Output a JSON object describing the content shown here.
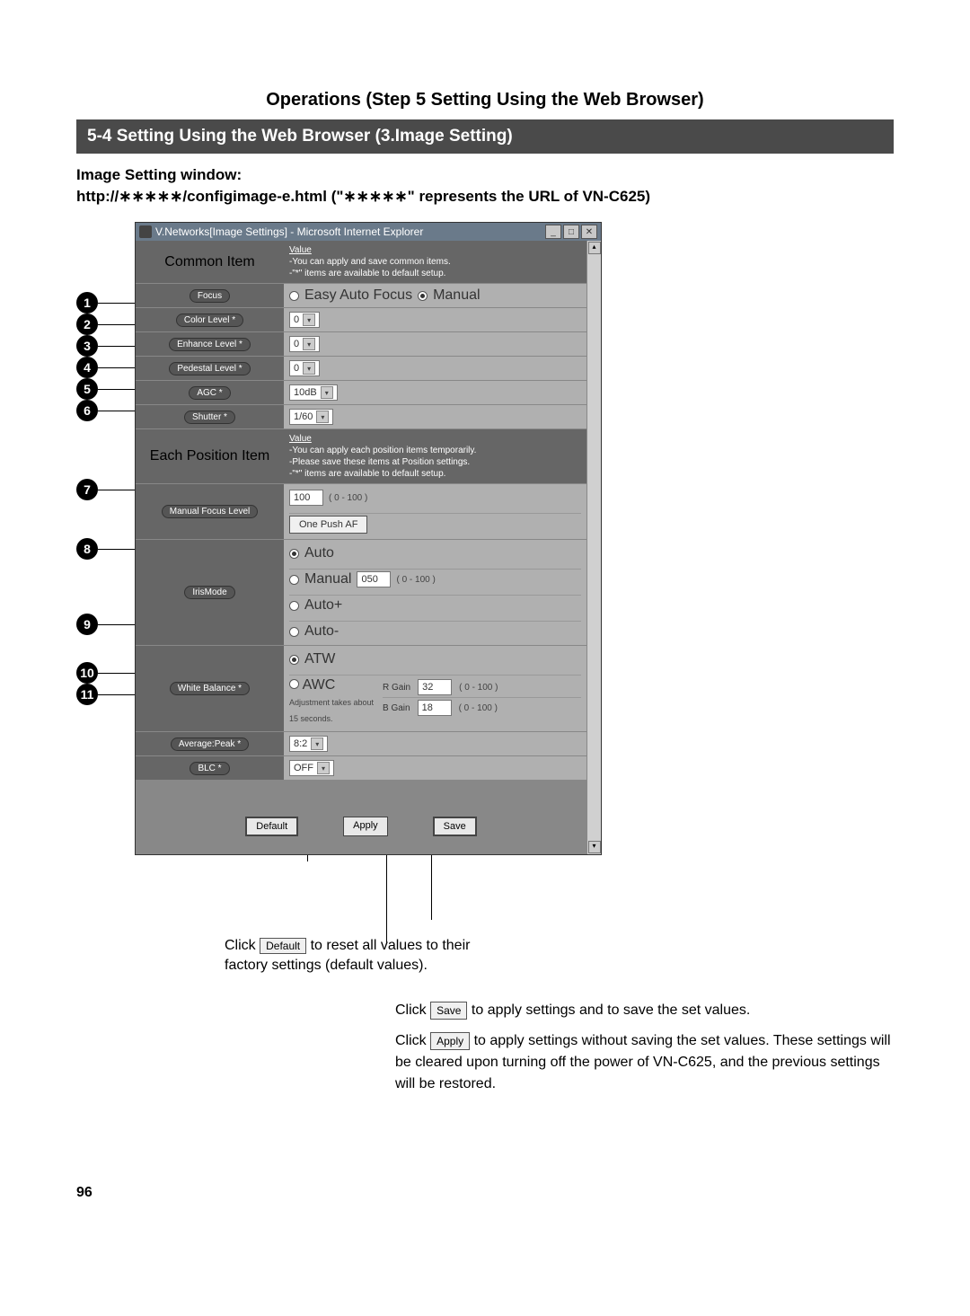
{
  "header": "Operations (Step 5 Setting Using the Web Browser)",
  "section_title": "5-4 Setting Using the Web Browser (3.Image Setting)",
  "intro_line1": "Image Setting window:",
  "intro_line2": "http://∗∗∗∗∗/configimage-e.html (\"∗∗∗∗∗\" represents the URL of VN-C625)",
  "window_title": "V.Networks[Image Settings] - Microsoft Internet Explorer",
  "common_item": {
    "label": "Common Item",
    "value_title": "Value",
    "value_line1": "-You can apply and save common items.",
    "value_line2": "-\"*\" items are available to default setup."
  },
  "rows": {
    "focus": {
      "label": "Focus",
      "opt1": "Easy Auto Focus",
      "opt2": "Manual"
    },
    "color_level": {
      "label": "Color Level *",
      "value": "0"
    },
    "enhance_level": {
      "label": "Enhance Level *",
      "value": "0"
    },
    "pedestal_level": {
      "label": "Pedestal Level *",
      "value": "0"
    },
    "agc": {
      "label": "AGC *",
      "value": "10dB"
    },
    "shutter": {
      "label": "Shutter *",
      "value": "1/60"
    }
  },
  "each_position": {
    "label": "Each Position Item",
    "value_title": "Value",
    "line1": "-You can apply each position items temporarily.",
    "line2": "-Please save these items at Position settings.",
    "line3": "-\"*\" items are available to default setup."
  },
  "manual_focus": {
    "label": "Manual Focus Level",
    "value": "100",
    "range": "( 0 - 100 )",
    "button": "One Push AF"
  },
  "iris_mode": {
    "label": "IrisMode",
    "opt1": "Auto",
    "opt2": "Manual",
    "opt2_val": "050",
    "opt2_range": "( 0 - 100 )",
    "opt3": "Auto+",
    "opt4": "Auto-"
  },
  "white_balance": {
    "label": "White Balance *",
    "opt1": "ATW",
    "opt2": "AWC",
    "opt2_note": "Adjustment takes about 15 seconds.",
    "r_gain_label": "R Gain",
    "r_gain_val": "32",
    "r_gain_range": "( 0 - 100 )",
    "b_gain_label": "B Gain",
    "b_gain_val": "18",
    "b_gain_range": "( 0 - 100 )"
  },
  "avg_peak": {
    "label": "Average:Peak *",
    "value": "8:2"
  },
  "blc": {
    "label": "BLC *",
    "value": "OFF"
  },
  "footer_buttons": {
    "default": "Default",
    "apply": "Apply",
    "save": "Save"
  },
  "desc_default_prefix": "Click ",
  "desc_default_btn": "Default",
  "desc_default_suffix": " to reset all values to their factory settings (default values).",
  "desc_save_prefix": "Click ",
  "desc_save_btn": "Save",
  "desc_save_suffix": " to apply settings and to save the set values.",
  "desc_apply_prefix": "Click ",
  "desc_apply_btn": "Apply",
  "desc_apply_suffix": " to apply settings without saving the set values. These settings will be cleared upon turning off the power of VN-C625, and the previous settings will be restored.",
  "page_number": "96",
  "callouts": [
    "1",
    "2",
    "3",
    "4",
    "5",
    "6",
    "7",
    "8",
    "9",
    "10",
    "11"
  ]
}
